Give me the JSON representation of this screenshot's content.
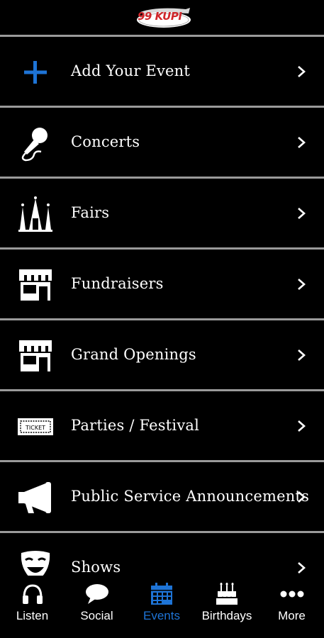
{
  "header": {
    "logo_text": "99 KUPI"
  },
  "events": {
    "items": [
      {
        "label": "Add Your Event",
        "icon": "plus-icon"
      },
      {
        "label": "Concerts",
        "icon": "microphone-icon"
      },
      {
        "label": "Fairs",
        "icon": "fair-rides-icon"
      },
      {
        "label": "Fundraisers",
        "icon": "storefront-icon"
      },
      {
        "label": "Grand Openings",
        "icon": "storefront-icon"
      },
      {
        "label": "Parties / Festival",
        "icon": "ticket-icon"
      },
      {
        "label": "Public Service Announcements",
        "icon": "megaphone-icon"
      },
      {
        "label": "Shows",
        "icon": "theater-mask-icon"
      }
    ],
    "ticket_text": "TICKET"
  },
  "tabbar": {
    "tabs": [
      {
        "label": "Listen",
        "icon": "headphones-icon",
        "active": false
      },
      {
        "label": "Social",
        "icon": "chat-bubble-icon",
        "active": false
      },
      {
        "label": "Events",
        "icon": "calendar-icon",
        "active": true
      },
      {
        "label": "Birthdays",
        "icon": "birthday-cake-icon",
        "active": false
      },
      {
        "label": "More",
        "icon": "more-dots-icon",
        "active": false
      }
    ]
  },
  "colors": {
    "accent": "#1e74d6",
    "divider": "#9a9a9a",
    "background": "#000000",
    "logo_red": "#d0262a"
  }
}
